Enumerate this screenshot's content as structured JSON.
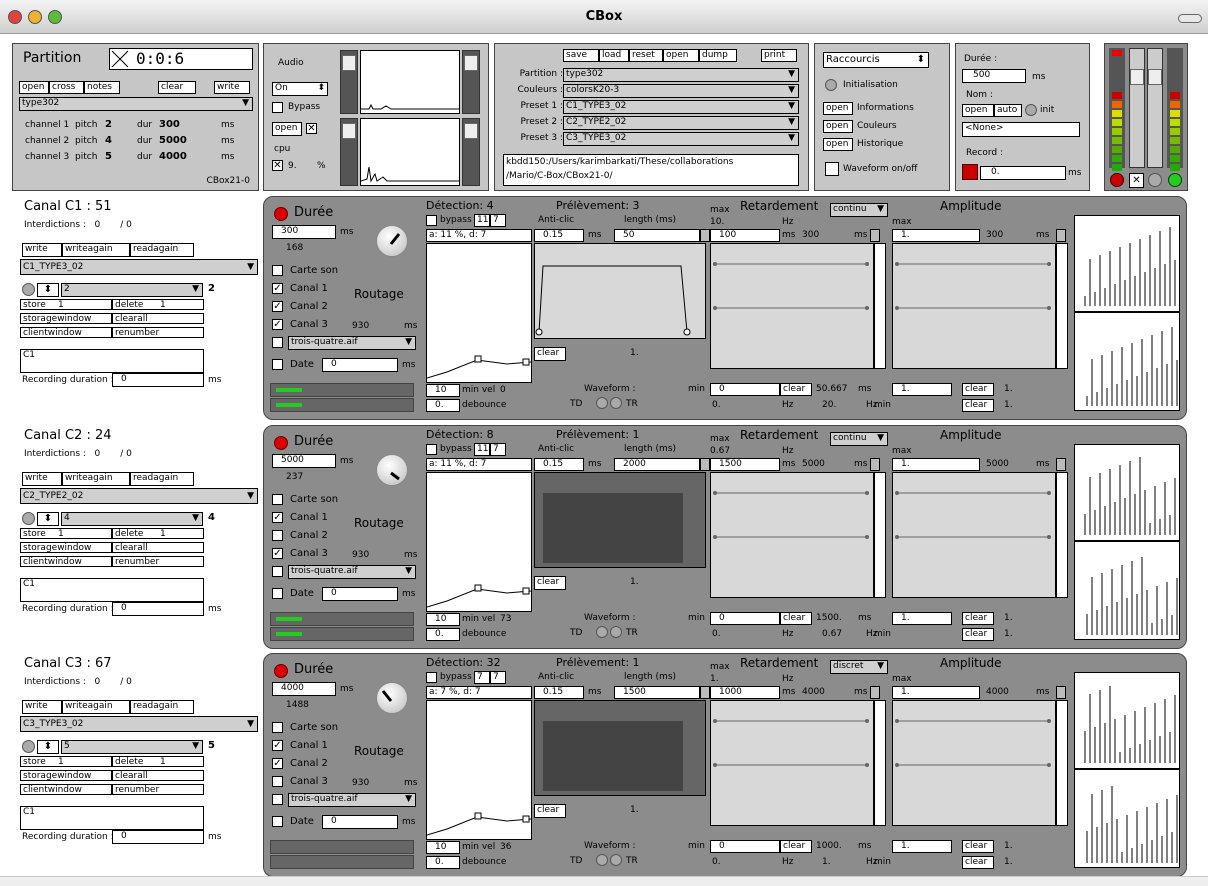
{
  "window": {
    "title": "CBox"
  },
  "partition": {
    "title": "Partition",
    "time": "0:0:6",
    "buttons": {
      "open": "open",
      "cross": "cross",
      "notes": "notes",
      "clear": "clear",
      "write": "write"
    },
    "selected": "type302",
    "channels": [
      {
        "channel": "channel 1",
        "pitch_label": "pitch",
        "pitch": "2",
        "dur_label": "dur",
        "dur": "300",
        "unit": "ms"
      },
      {
        "channel": "channel 2",
        "pitch_label": "pitch",
        "pitch": "4",
        "dur_label": "dur",
        "dur": "5000",
        "unit": "ms"
      },
      {
        "channel": "channel 3",
        "pitch_label": "pitch",
        "pitch": "5",
        "dur_label": "dur",
        "dur": "4000",
        "unit": "ms"
      }
    ],
    "version": "CBox21-0"
  },
  "audio": {
    "title": "Audio",
    "state": "On",
    "bypass": "Bypass",
    "open": "open",
    "cpu_label": "cpu",
    "cpu_value": "9.",
    "cpu_unit": "%"
  },
  "presets": {
    "buttons": {
      "save": "save",
      "load": "load",
      "reset": "reset",
      "open": "open",
      "dump": "dump",
      "print": "print"
    },
    "rows": [
      {
        "label": "Partition :",
        "value": "type302"
      },
      {
        "label": "Couleurs :",
        "value": "colorsK20-3"
      },
      {
        "label": "Preset 1 :",
        "value": "C1_TYPE3_02"
      },
      {
        "label": "Preset 2 :",
        "value": "C2_TYPE2_02"
      },
      {
        "label": "Preset 3 :",
        "value": "C3_TYPE3_02"
      }
    ],
    "path_line1": "kbdd150:/Users/karimbarkati/These/collaborations",
    "path_line2": "/Mario/C-Box/CBox21-0/"
  },
  "shortcuts": {
    "menu": "Raccourcis",
    "init": "Initialisation",
    "open": "open",
    "items": [
      "Informations",
      "Couleurs",
      "Historique"
    ],
    "waveform": "Waveform on/off"
  },
  "duree": {
    "title": "Durée :",
    "value": "500",
    "unit": "ms",
    "nom_label": "Nom :",
    "open": "open",
    "auto": "auto",
    "init": "init",
    "none": "<None>",
    "record_label": "Record :",
    "record_value": "0.",
    "record_unit": "ms"
  },
  "common": {
    "write": "write",
    "writeagain": "writeagain",
    "readagain": "readagain",
    "store": "store",
    "delete": "delete",
    "storagewindow": "storagewindow",
    "clearall": "clearall",
    "clientwindow": "clientwindow",
    "renumber": "renumber",
    "client": "C1",
    "rec_label": "Recording duration :",
    "rec_value": "0",
    "ms": "ms",
    "duree": "Durée",
    "carte": "Carte son",
    "canal1": "Canal 1",
    "canal2": "Canal 2",
    "canal3": "Canal 3",
    "routage": "Routage",
    "canal3_val": "930",
    "aif": "trois-quatre.aif",
    "date": "Date",
    "date_val": "0",
    "bypass": "bypass",
    "anticlic": "Anti-clic",
    "length": "length (ms)",
    "anticlic_val": "0.15",
    "clear": "clear",
    "one": "1.",
    "min_vel": "min vel",
    "debounce": "debounce",
    "debounce_val": "0.",
    "waveform": "Waveform :",
    "td": "TD",
    "tr": "TR",
    "min": "min",
    "max": "max",
    "hz": "Hz",
    "retard": "Retardement",
    "ampl": "Amplitude",
    "amp_min": "1.",
    "amp_max": "1.",
    "ten": "10"
  },
  "canals": [
    {
      "title": "Canal C1 : 51",
      "interdictions": "Interdictions :   0       / 0",
      "preset": "C1_TYPE3_02",
      "num": "2",
      "storenum": "1",
      "delnum": "1",
      "duree_val": "300",
      "duree_sub": "168",
      "detection": "Détection: 4",
      "bp1": "11",
      "bp2": "7",
      "det_info": "a: 11 %, d: 7",
      "minvel": "0",
      "prel": "Prélèvement: 3",
      "len": "50",
      "ret_mode": "continu",
      "ret_max": "10.",
      "ret_lo": "100",
      "ret_hi": "300",
      "ret_min": "0",
      "ret_cl": "50.667",
      "ret_min2": "0.",
      "ret_cl2": "20.",
      "amp_hi": "300"
    },
    {
      "title": "Canal C2 : 24",
      "interdictions": "Interdictions :   0       / 0",
      "preset": "C2_TYPE2_02",
      "num": "4",
      "storenum": "1",
      "delnum": "1",
      "duree_val": "5000",
      "duree_sub": "237",
      "detection": "Détection: 8",
      "bp1": "11",
      "bp2": "7",
      "det_info": "a: 11 %, d: 7",
      "minvel": "73",
      "prel": "Prélèvement: 1",
      "len": "2000",
      "ret_mode": "continu",
      "ret_max": "0.67",
      "ret_lo": "1500",
      "ret_hi": "5000",
      "ret_min": "0",
      "ret_cl": "1500.",
      "ret_min2": "0.",
      "ret_cl2": "0.67",
      "amp_hi": "5000"
    },
    {
      "title": "Canal C3 : 67",
      "interdictions": "Interdictions :   0       / 0",
      "preset": "C3_TYPE3_02",
      "num": "5",
      "storenum": "1",
      "delnum": "1",
      "duree_val": "4000",
      "duree_sub": "1488",
      "detection": "Détection: 32",
      "bp1": "7",
      "bp2": "7",
      "det_info": "a: 7 %, d: 7",
      "minvel": "36",
      "prel": "Prélèvement: 1",
      "len": "1500",
      "ret_mode": "discret",
      "ret_max": "1.",
      "ret_lo": "1000",
      "ret_hi": "4000",
      "ret_min": "0",
      "ret_cl": "1000.",
      "ret_min2": "0.",
      "ret_cl2": "1.",
      "amp_hi": "4000"
    }
  ]
}
